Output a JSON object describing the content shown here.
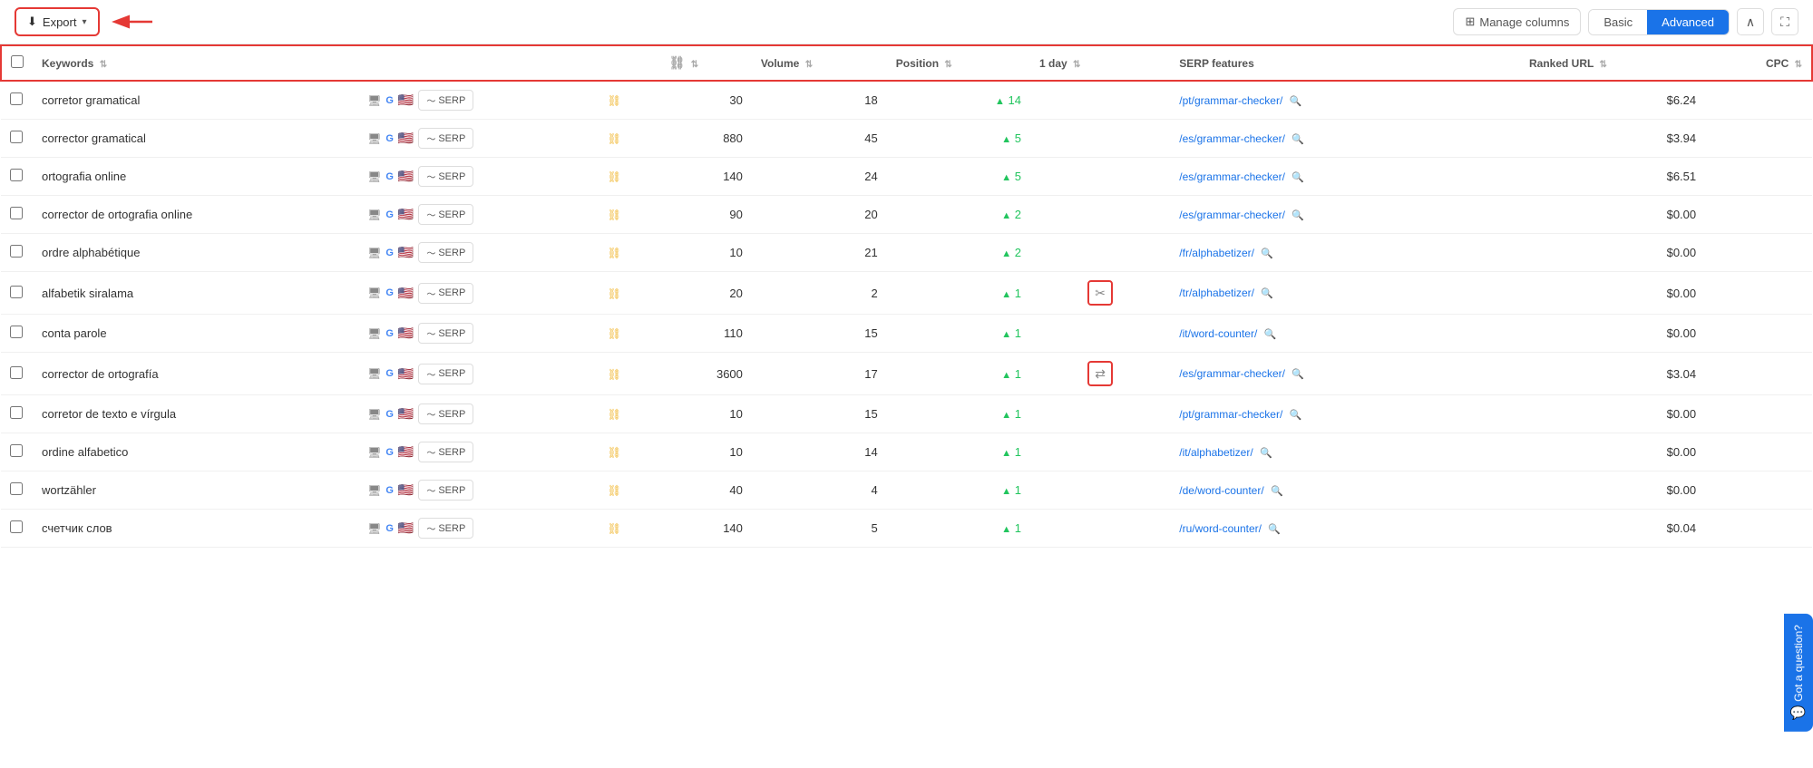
{
  "toolbar": {
    "export_label": "Export",
    "manage_columns_label": "Manage columns",
    "basic_label": "Basic",
    "advanced_label": "Advanced"
  },
  "table": {
    "columns": [
      {
        "key": "checkbox",
        "label": ""
      },
      {
        "key": "keyword",
        "label": "Keywords",
        "sortable": true
      },
      {
        "key": "icons",
        "label": ""
      },
      {
        "key": "link",
        "label": "",
        "sortable": false
      },
      {
        "key": "volume",
        "label": "Volume",
        "sortable": true
      },
      {
        "key": "position",
        "label": "Position",
        "sortable": true
      },
      {
        "key": "day1",
        "label": "1 day",
        "sortable": true
      },
      {
        "key": "serp",
        "label": "SERP features"
      },
      {
        "key": "url",
        "label": "Ranked URL",
        "sortable": true
      },
      {
        "key": "cpc",
        "label": "CPC",
        "sortable": true
      }
    ],
    "rows": [
      {
        "keyword": "corretor gramatical",
        "volume": "30",
        "position": "18",
        "day_change": "14",
        "day_up": true,
        "serp_icon": null,
        "url": "/pt/grammar-checker/",
        "cpc": "$6.24",
        "chain_color": "gold"
      },
      {
        "keyword": "corrector gramatical",
        "volume": "880",
        "position": "45",
        "day_change": "5",
        "day_up": true,
        "serp_icon": null,
        "url": "/es/grammar-checker/",
        "cpc": "$3.94",
        "chain_color": "gold"
      },
      {
        "keyword": "ortografia online",
        "volume": "140",
        "position": "24",
        "day_change": "5",
        "day_up": true,
        "serp_icon": null,
        "url": "/es/grammar-checker/",
        "cpc": "$6.51",
        "chain_color": "gold"
      },
      {
        "keyword": "corrector de ortografia online",
        "volume": "90",
        "position": "20",
        "day_change": "2",
        "day_up": true,
        "serp_icon": null,
        "url": "/es/grammar-checker/",
        "cpc": "$0.00",
        "chain_color": "gold"
      },
      {
        "keyword": "ordre alphabétique",
        "volume": "10",
        "position": "21",
        "day_change": "2",
        "day_up": true,
        "serp_icon": null,
        "url": "/fr/alphabetizer/",
        "cpc": "$0.00",
        "chain_color": "gold"
      },
      {
        "keyword": "alfabetik siralama",
        "volume": "20",
        "position": "2",
        "day_change": "1",
        "day_up": true,
        "serp_icon": "scissors",
        "url": "/tr/alphabetizer/",
        "cpc": "$0.00",
        "chain_color": "gold"
      },
      {
        "keyword": "conta parole",
        "volume": "110",
        "position": "15",
        "day_change": "1",
        "day_up": true,
        "serp_icon": null,
        "url": "/it/word-counter/",
        "cpc": "$0.00",
        "chain_color": "gold"
      },
      {
        "keyword": "corrector de ortografía",
        "volume": "3600",
        "position": "17",
        "day_change": "1",
        "day_up": true,
        "serp_icon": "swap",
        "url": "/es/grammar-checker/",
        "cpc": "$3.04",
        "chain_color": "gold"
      },
      {
        "keyword": "corretor de texto e vírgula",
        "volume": "10",
        "position": "15",
        "day_change": "1",
        "day_up": true,
        "serp_icon": null,
        "url": "/pt/grammar-checker/",
        "cpc": "$0.00",
        "chain_color": "gold"
      },
      {
        "keyword": "ordine alfabetico",
        "volume": "10",
        "position": "14",
        "day_change": "1",
        "day_up": true,
        "serp_icon": null,
        "url": "/it/alphabetizer/",
        "cpc": "$0.00",
        "chain_color": "gold"
      },
      {
        "keyword": "wortzähler",
        "volume": "40",
        "position": "4",
        "day_change": "1",
        "day_up": true,
        "serp_icon": null,
        "url": "/de/word-counter/",
        "cpc": "$0.00",
        "chain_color": "gold"
      },
      {
        "keyword": "счетчик слов",
        "volume": "140",
        "position": "5",
        "day_change": "1",
        "day_up": true,
        "serp_icon": null,
        "url": "/ru/word-counter/",
        "cpc": "$0.04",
        "chain_color": "gold"
      }
    ]
  },
  "chat_widget": {
    "label": "Got a question?"
  }
}
